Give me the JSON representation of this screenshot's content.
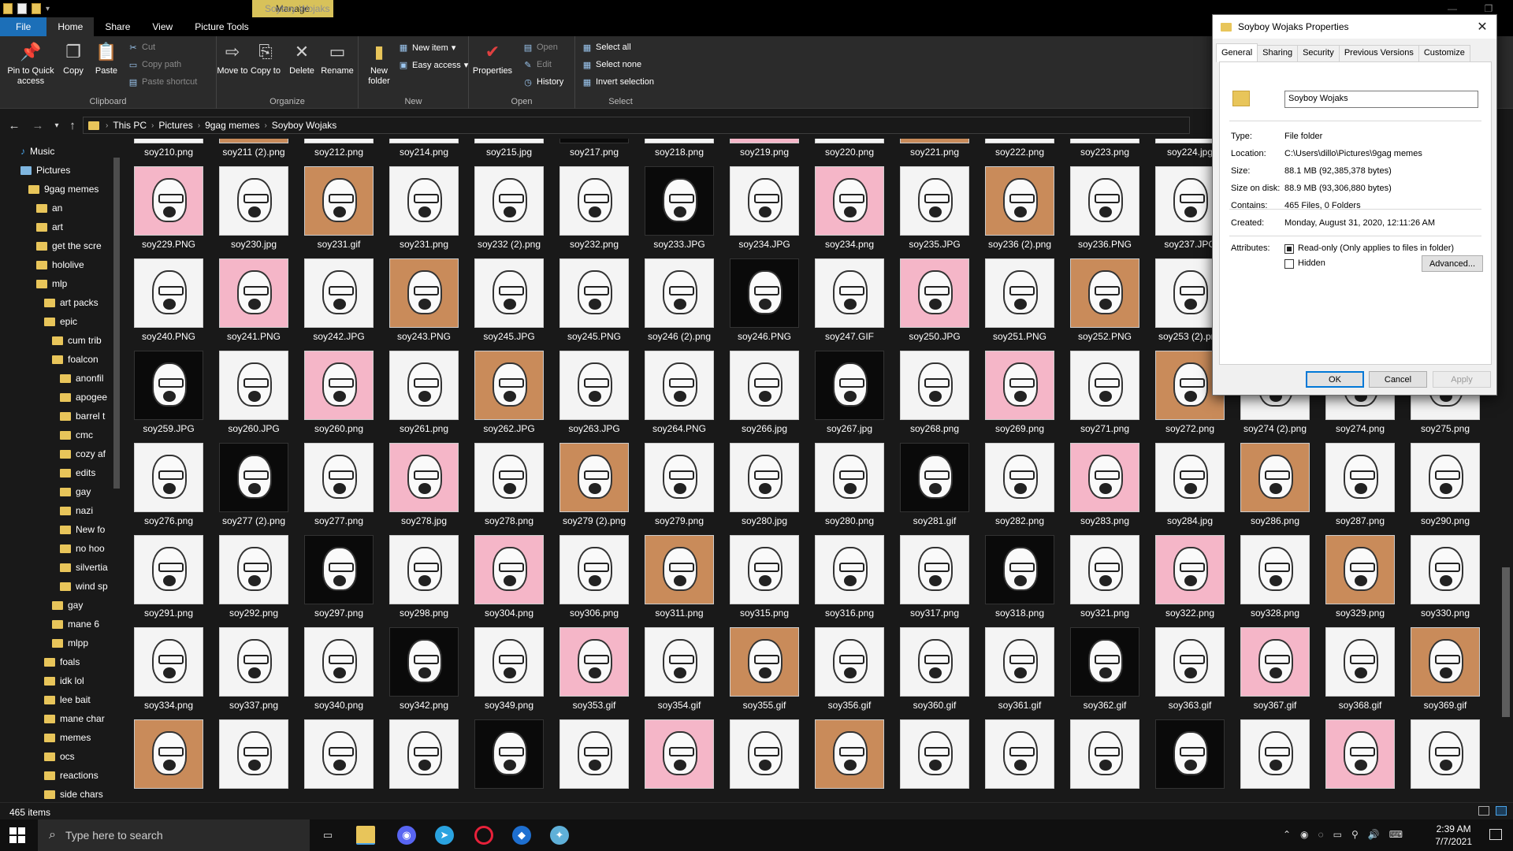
{
  "window": {
    "title": "Soyboy Wojaks",
    "manage_tab": "Manage"
  },
  "ribbon_tabs": [
    "File",
    "Home",
    "Share",
    "View",
    "Picture Tools"
  ],
  "ribbon": {
    "clipboard": {
      "label": "Clipboard",
      "pin": "Pin to Quick access",
      "copy": "Copy",
      "paste": "Paste",
      "cut": "Cut",
      "copy_path": "Copy path",
      "paste_shortcut": "Paste shortcut"
    },
    "organize": {
      "label": "Organize",
      "move_to": "Move to",
      "copy_to": "Copy to",
      "delete": "Delete",
      "rename": "Rename"
    },
    "new": {
      "label": "New",
      "new_folder": "New folder",
      "new_item": "New item",
      "easy_access": "Easy access"
    },
    "open": {
      "label": "Open",
      "properties": "Properties",
      "open": "Open",
      "edit": "Edit",
      "history": "History"
    },
    "select": {
      "label": "Select",
      "select_all": "Select all",
      "select_none": "Select none",
      "invert": "Invert selection"
    }
  },
  "address": {
    "crumbs": [
      "This PC",
      "Pictures",
      "9gag memes",
      "Soyboy Wojaks"
    ]
  },
  "nav": [
    {
      "label": "Music",
      "indent": 1,
      "kind": "music"
    },
    {
      "label": "Pictures",
      "indent": 1,
      "kind": "pictures"
    },
    {
      "label": "9gag memes",
      "indent": 2
    },
    {
      "label": "an",
      "indent": 3
    },
    {
      "label": "art",
      "indent": 3
    },
    {
      "label": "get the scre",
      "indent": 3
    },
    {
      "label": "hololive",
      "indent": 3
    },
    {
      "label": "mlp",
      "indent": 3
    },
    {
      "label": "art packs",
      "indent": 4
    },
    {
      "label": "epic",
      "indent": 4
    },
    {
      "label": "cum trib",
      "indent": 5
    },
    {
      "label": "foalcon",
      "indent": 5
    },
    {
      "label": "anonfil",
      "indent": 6
    },
    {
      "label": "apogee",
      "indent": 6
    },
    {
      "label": "barrel t",
      "indent": 6
    },
    {
      "label": "cmc",
      "indent": 6
    },
    {
      "label": "cozy af",
      "indent": 6
    },
    {
      "label": "edits",
      "indent": 6
    },
    {
      "label": "gay",
      "indent": 6
    },
    {
      "label": "nazi",
      "indent": 6
    },
    {
      "label": "New fo",
      "indent": 6
    },
    {
      "label": "no hoo",
      "indent": 6
    },
    {
      "label": "silvertia",
      "indent": 6
    },
    {
      "label": "wind sp",
      "indent": 6
    },
    {
      "label": "gay",
      "indent": 5
    },
    {
      "label": "mane 6",
      "indent": 5
    },
    {
      "label": "mlpp",
      "indent": 5
    },
    {
      "label": "foals",
      "indent": 4
    },
    {
      "label": "idk lol",
      "indent": 4
    },
    {
      "label": "lee bait",
      "indent": 4
    },
    {
      "label": "mane char",
      "indent": 4
    },
    {
      "label": "memes",
      "indent": 4
    },
    {
      "label": "ocs",
      "indent": 4
    },
    {
      "label": "reactions",
      "indent": 4
    },
    {
      "label": "side chars",
      "indent": 4
    }
  ],
  "files": [
    [
      "soy210.png",
      "soy211 (2).png",
      "soy212.png",
      "soy214.png",
      "soy215.jpg",
      "soy217.png",
      "soy218.png",
      "soy219.png",
      "soy220.png",
      "soy221.png",
      "soy222.png",
      "soy223.png",
      "soy224.jpg"
    ],
    [
      "soy229.PNG",
      "soy230.jpg",
      "soy231.gif",
      "soy231.png",
      "soy232 (2).png",
      "soy232.png",
      "soy233.JPG",
      "soy234.JPG",
      "soy234.png",
      "soy235.JPG",
      "soy236 (2).png",
      "soy236.PNG",
      "soy237.JPG"
    ],
    [
      "soy240.PNG",
      "soy241.PNG",
      "soy242.JPG",
      "soy243.PNG",
      "soy245.JPG",
      "soy245.PNG",
      "soy246 (2).png",
      "soy246.PNG",
      "soy247.GIF",
      "soy250.JPG",
      "soy251.PNG",
      "soy252.PNG",
      "soy253 (2).png"
    ],
    [
      "soy259.JPG",
      "soy260.JPG",
      "soy260.png",
      "soy261.png",
      "soy262.JPG",
      "soy263.JPG",
      "soy264.PNG",
      "soy266.jpg",
      "soy267.jpg",
      "soy268.png",
      "soy269.png",
      "soy271.png",
      "soy272.png",
      "soy274 (2).png",
      "soy274.png",
      "soy275.png"
    ],
    [
      "soy276.png",
      "soy277 (2).png",
      "soy277.png",
      "soy278.jpg",
      "soy278.png",
      "soy279 (2).png",
      "soy279.png",
      "soy280.jpg",
      "soy280.png",
      "soy281.gif",
      "soy282.png",
      "soy283.png",
      "soy284.jpg",
      "soy286.png",
      "soy287.png",
      "soy290.png"
    ],
    [
      "soy291.png",
      "soy292.png",
      "soy297.png",
      "soy298.png",
      "soy304.png",
      "soy306.png",
      "soy311.png",
      "soy315.png",
      "soy316.png",
      "soy317.png",
      "soy318.png",
      "soy321.png",
      "soy322.png",
      "soy328.png",
      "soy329.png",
      "soy330.png"
    ],
    [
      "soy334.png",
      "soy337.png",
      "soy340.png",
      "soy342.png",
      "soy349.png",
      "soy353.gif",
      "soy354.gif",
      "soy355.gif",
      "soy356.gif",
      "soy360.gif",
      "soy361.gif",
      "soy362.gif",
      "soy363.gif",
      "soy367.gif",
      "soy368.gif",
      "soy369.gif"
    ],
    [
      "",
      "",
      "",
      "",
      "",
      "",
      "",
      "",
      "",
      "",
      "",
      "",
      "",
      "",
      "",
      ""
    ]
  ],
  "status": {
    "item_count": "465 items"
  },
  "taskbar": {
    "search_placeholder": "Type here to search",
    "time": "2:39 AM",
    "date": "7/7/2021"
  },
  "dialog": {
    "title": "Soyboy Wojaks Properties",
    "tabs": [
      "General",
      "Sharing",
      "Security",
      "Previous Versions",
      "Customize"
    ],
    "name": "Soyboy Wojaks",
    "rows": [
      {
        "label": "Type:",
        "value": "File folder"
      },
      {
        "label": "Location:",
        "value": "C:\\Users\\dillo\\Pictures\\9gag memes"
      },
      {
        "label": "Size:",
        "value": "88.1 MB (92,385,378 bytes)"
      },
      {
        "label": "Size on disk:",
        "value": "88.9 MB (93,306,880 bytes)"
      },
      {
        "label": "Contains:",
        "value": "465 Files, 0 Folders"
      }
    ],
    "created_label": "Created:",
    "created": "Monday, August 31, 2020, 12:11:26 AM",
    "attributes_label": "Attributes:",
    "readonly": "Read-only (Only applies to files in folder)",
    "hidden": "Hidden",
    "advanced": "Advanced...",
    "ok": "OK",
    "cancel": "Cancel",
    "apply": "Apply"
  }
}
